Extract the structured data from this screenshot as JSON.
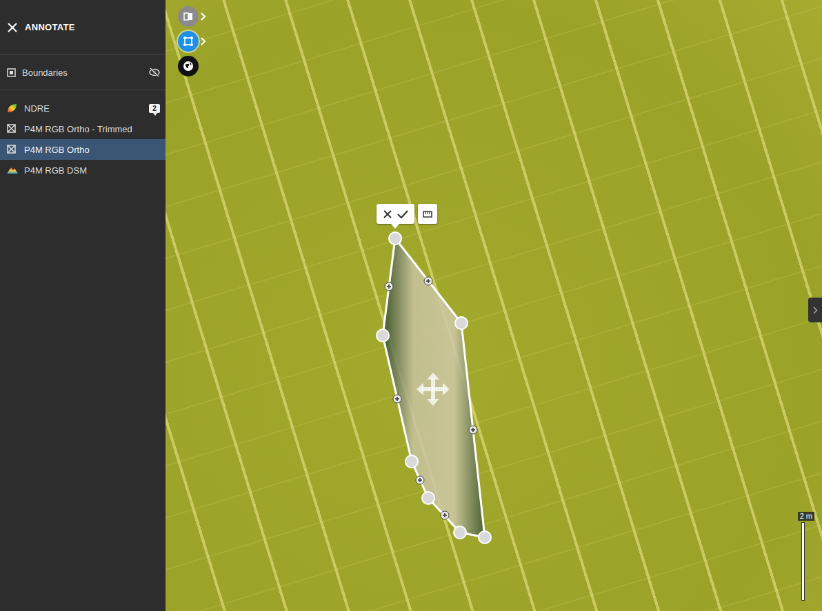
{
  "sidebar": {
    "title": "ANNOTATE"
  },
  "boundaries": {
    "label": "Boundaries",
    "visible": false
  },
  "layers": [
    {
      "label": "NDRE",
      "kind": "index",
      "badge": "2",
      "selected": false
    },
    {
      "label": "P4M RGB Ortho - Trimmed",
      "kind": "ortho",
      "selected": false
    },
    {
      "label": "P4M RGB Ortho",
      "kind": "ortho",
      "selected": true
    },
    {
      "label": "P4M RGB DSM",
      "kind": "dsm",
      "selected": false
    }
  ],
  "map_tools": [
    {
      "kind": "compare",
      "selected": false
    },
    {
      "kind": "draw",
      "selected": true
    },
    {
      "kind": "globe",
      "selected": false
    }
  ],
  "scale": {
    "label": "2 m"
  }
}
